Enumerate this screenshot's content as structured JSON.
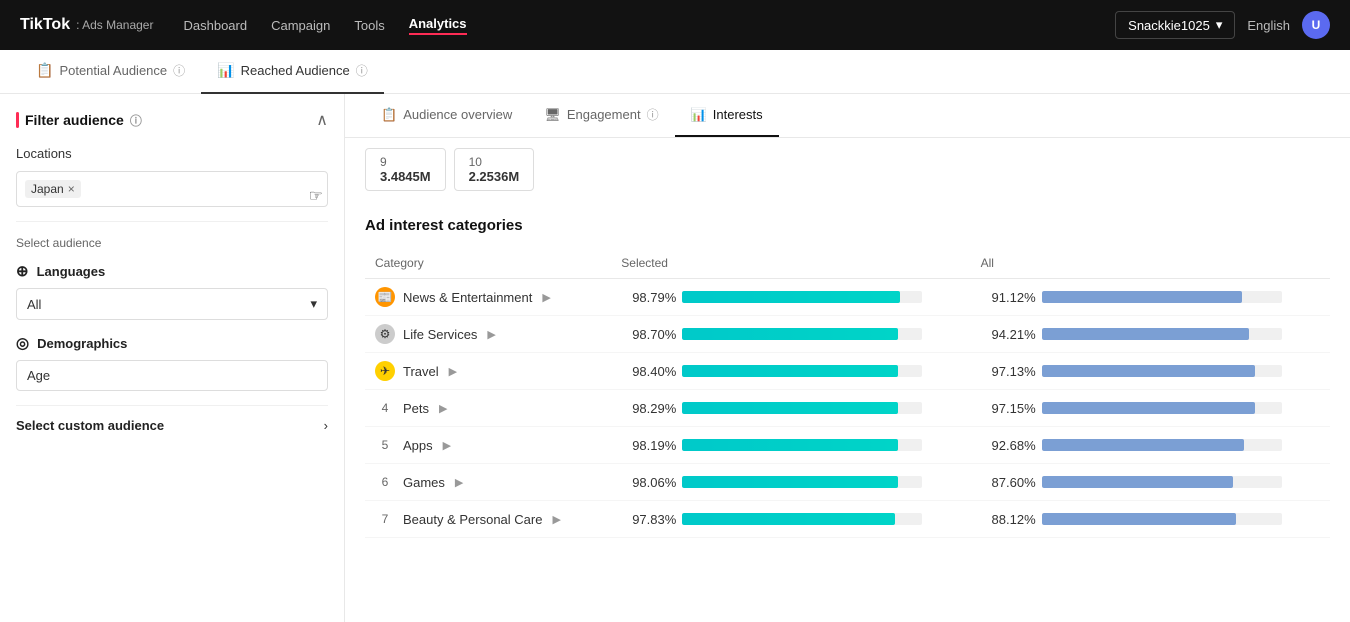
{
  "app": {
    "name": "TikTok",
    "sub": ": Ads Manager"
  },
  "topnav": {
    "links": [
      {
        "label": "Dashboard",
        "active": false
      },
      {
        "label": "Campaign",
        "active": false
      },
      {
        "label": "Tools",
        "active": false
      },
      {
        "label": "Analytics",
        "active": true
      }
    ],
    "account": "Snackkie1025",
    "language": "English",
    "avatar": "U"
  },
  "page_tabs": [
    {
      "label": "Potential Audience",
      "icon": "📋",
      "active": false,
      "has_info": true
    },
    {
      "label": "Reached Audience",
      "icon": "📊",
      "active": true,
      "has_info": true
    }
  ],
  "sidebar": {
    "filter_title": "Filter audience",
    "sections": {
      "locations_label": "Locations",
      "location_tag": "Japan",
      "select_audience_label": "Select audience",
      "languages_label": "Languages",
      "languages_value": "All",
      "demographics_label": "Demographics",
      "age_label": "Age",
      "custom_audience_label": "Select custom audience"
    }
  },
  "inner_tabs": [
    {
      "label": "Audience overview",
      "icon": "📋",
      "active": false
    },
    {
      "label": "Engagement",
      "icon": "🖥",
      "active": false,
      "has_info": true
    },
    {
      "label": "Interests",
      "icon": "📊",
      "active": true
    }
  ],
  "stats": [
    {
      "number": "9",
      "value": "3.4845M"
    },
    {
      "number": "10",
      "value": "2.2536M"
    }
  ],
  "ad_categories": {
    "title": "Ad interest categories",
    "columns": {
      "category": "Category",
      "selected": "Selected",
      "all": "All"
    },
    "rows": [
      {
        "rank": null,
        "icon": "orange",
        "icon_char": "📰",
        "name": "News & Entertainment",
        "has_arrow": true,
        "selected_pct": "98.79%",
        "all_pct": "91.12%",
        "selected_bar": 99,
        "all_bar": 91
      },
      {
        "rank": null,
        "icon": "gray",
        "icon_char": "⚙",
        "name": "Life Services",
        "has_arrow": true,
        "selected_pct": "98.70%",
        "all_pct": "94.21%",
        "selected_bar": 98,
        "all_bar": 94
      },
      {
        "rank": null,
        "icon": "yellow",
        "icon_char": "✈",
        "name": "Travel",
        "has_arrow": true,
        "selected_pct": "98.40%",
        "all_pct": "97.13%",
        "selected_bar": 98,
        "all_bar": 97
      },
      {
        "rank": "4",
        "icon": "num",
        "icon_char": "",
        "name": "Pets",
        "has_arrow": true,
        "selected_pct": "98.29%",
        "all_pct": "97.15%",
        "selected_bar": 98,
        "all_bar": 97
      },
      {
        "rank": "5",
        "icon": "num",
        "icon_char": "",
        "name": "Apps",
        "has_arrow": true,
        "selected_pct": "98.19%",
        "all_pct": "92.68%",
        "selected_bar": 98,
        "all_bar": 92
      },
      {
        "rank": "6",
        "icon": "num",
        "icon_char": "",
        "name": "Games",
        "has_arrow": true,
        "selected_pct": "98.06%",
        "all_pct": "87.60%",
        "selected_bar": 98,
        "all_bar": 87
      },
      {
        "rank": "7",
        "icon": "num",
        "icon_char": "",
        "name": "Beauty & Personal Care",
        "has_arrow": true,
        "selected_pct": "97.83%",
        "all_pct": "88.12%",
        "selected_bar": 97,
        "all_bar": 88
      }
    ]
  }
}
